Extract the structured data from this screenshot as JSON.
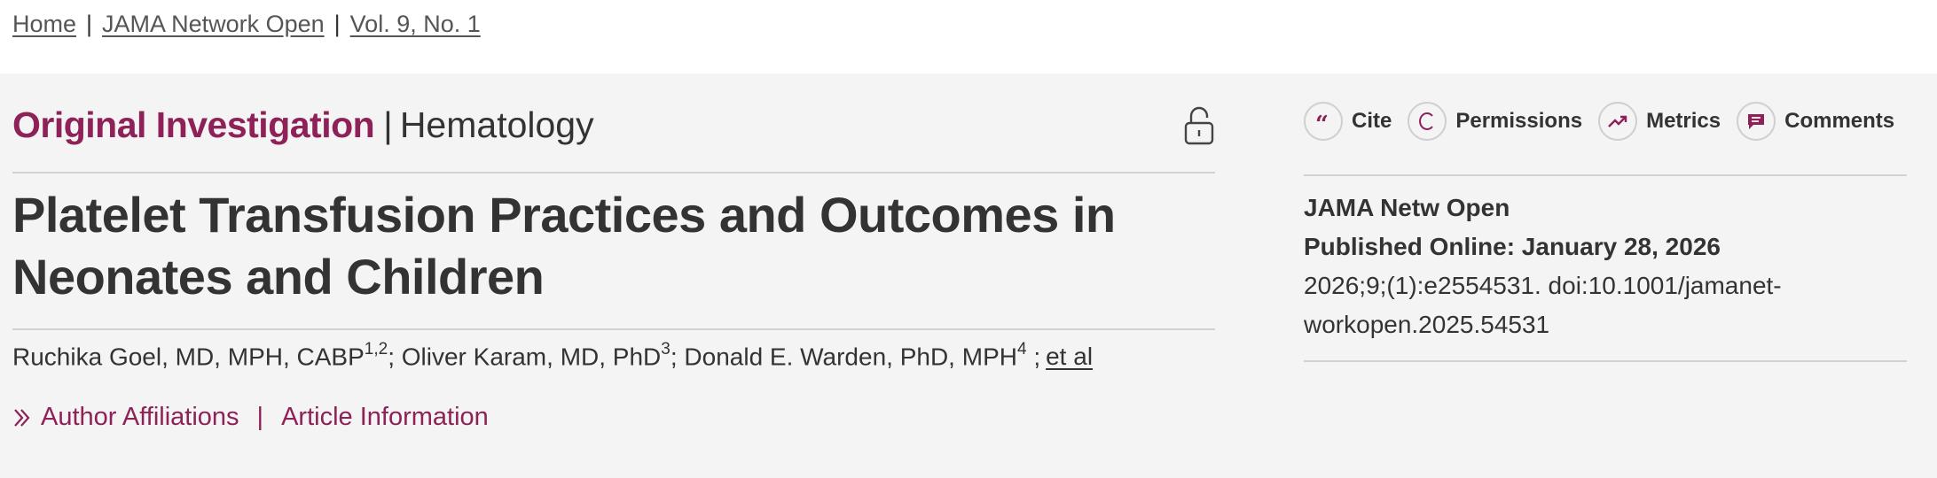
{
  "breadcrumb": {
    "items": [
      "Home",
      "JAMA Network Open",
      "Vol. 9, No. 1"
    ],
    "separator": "|"
  },
  "article": {
    "type": "Original Investigation",
    "pipe": "|",
    "subject": "Hematology",
    "title": "Platelet Transfusion Practices and Outcomes in Neonates and Children",
    "authors": [
      {
        "name": "Ruchika Goel, MD, MPH, CABP",
        "sup": "1,2",
        "sep": "; "
      },
      {
        "name": "Oliver Karam, MD, PhD",
        "sup": "3",
        "sep": "; "
      },
      {
        "name": "Donald E. Warden, PhD, MPH",
        "sup": "4",
        "sep": " ;"
      }
    ],
    "et_al": "et al",
    "links": {
      "affiliations": "Author Affiliations",
      "separator": "|",
      "info": "Article Information"
    }
  },
  "tools": {
    "cite": "Cite",
    "permissions": "Permissions",
    "metrics": "Metrics",
    "comments": "Comments"
  },
  "meta": {
    "journal": "JAMA Netw Open",
    "published": "Published Online: January 28, 2026",
    "citation": "2026;9;(1):e2554531. doi:10.1001/jamanet-",
    "citation_cont": "workopen.2025.54531"
  },
  "colors": {
    "accent": "#8e2157",
    "text": "#333333",
    "panel_bg": "#f4f4f4"
  },
  "icons": [
    "lock-open-icon",
    "quote-icon",
    "copyright-icon",
    "trend-up-icon",
    "comment-icon",
    "chevron-double-right-icon"
  ]
}
